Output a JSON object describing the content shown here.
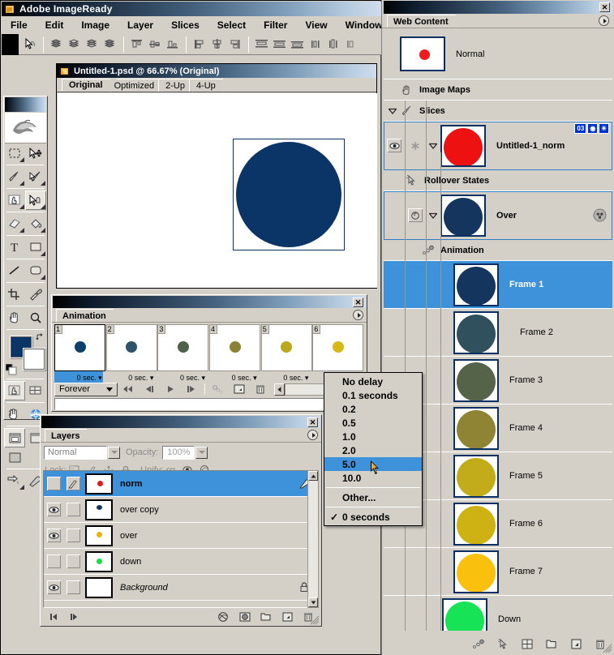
{
  "app": {
    "title": "Adobe ImageReady",
    "icon": "imageready-logo-icon",
    "menus": [
      "File",
      "Edit",
      "Image",
      "Layer",
      "Slices",
      "Select",
      "Filter",
      "View",
      "Window"
    ]
  },
  "document": {
    "title": "Untitled-1.psd @ 66.67% (Original)",
    "tabs": [
      "Original",
      "Optimized",
      "2-Up",
      "4-Up"
    ],
    "active_tab": "Original",
    "canvas_shape_color": "#0a3566"
  },
  "colors": {
    "foreground": "#0a3566",
    "background": "#ffffff",
    "selection_blue": "#3d92d9",
    "panel_gray": "#d4d0c8",
    "slice_badge_blue": "#0033cc"
  },
  "toolbox": {
    "tools": [
      "rectangular-marquee-icon",
      "move-icon",
      "slice-icon",
      "slice-select-icon",
      "image-map-tool-icon",
      "image-map-select-icon",
      "eraser-icon",
      "paint-bucket-icon",
      "type-icon",
      "rectangle-shape-icon",
      "line-icon",
      "rounded-rectangle-icon",
      "crop-icon",
      "eyedropper-icon",
      "hand-icon",
      "zoom-icon"
    ],
    "selected_tool": "image-map-select-icon",
    "swatch_swap": "swap-colors-icon",
    "swatch_default": "default-colors-icon",
    "mode_toggles": [
      "toggle-image-map-visibility-icon",
      "toggle-slices-visibility-icon"
    ],
    "preview_toggles": [
      "preview-document-icon",
      "preview-in-browser-icon"
    ],
    "screen_modes": [
      "standard-screen-mode-icon",
      "full-screen-menubar-icon",
      "full-screen-icon"
    ],
    "jump_to": [
      "jump-to-photoshop-icon",
      "edit-in-imageready-icon"
    ]
  },
  "options_bar": {
    "cursor_tool": "image-map-select-icon",
    "groups": [
      [
        "bring-to-front-icon",
        "bring-forward-icon",
        "send-backward-icon",
        "send-to-back-icon"
      ],
      [
        "align-left-icon",
        "align-horizontal-center-icon",
        "align-right-icon",
        "align-top-icon",
        "align-vertical-center-icon",
        "align-bottom-icon"
      ],
      [
        "distribute-top-icon",
        "distribute-vertical-center-icon",
        "distribute-bottom-icon",
        "distribute-left-icon",
        "distribute-horizontal-center-icon",
        "distribute-right-icon"
      ]
    ]
  },
  "animation_panel": {
    "title": "Animation",
    "close_label": "✕",
    "menu_icon": "panel-menu-icon",
    "loop_option": "Forever",
    "frames": [
      {
        "number": "1",
        "delay": "0 sec.",
        "color": "#0f3f6b",
        "selected": true
      },
      {
        "number": "2",
        "delay": "0 sec.",
        "color": "#2b5468",
        "selected": false
      },
      {
        "number": "3",
        "delay": "0 sec.",
        "color": "#4d6247",
        "selected": false
      },
      {
        "number": "4",
        "delay": "0 sec.",
        "color": "#8b8333",
        "selected": false
      },
      {
        "number": "5",
        "delay": "0 sec.",
        "color": "#bba91c",
        "selected": false
      },
      {
        "number": "6",
        "delay": "0 sec.",
        "color": "#d6b81a",
        "selected": false
      }
    ],
    "controls": [
      "select-first-frame-icon",
      "select-previous-frame-icon",
      "play-animation-icon",
      "select-next-frame-icon",
      "tween-icon",
      "duplicate-frame-icon",
      "delete-frame-icon"
    ]
  },
  "delay_menu": {
    "items": [
      {
        "label": "No delay",
        "highlighted": false,
        "checked": false
      },
      {
        "label": "0.1 seconds",
        "highlighted": false,
        "checked": false
      },
      {
        "label": "0.2",
        "highlighted": false,
        "checked": false
      },
      {
        "label": "0.5",
        "highlighted": false,
        "checked": false
      },
      {
        "label": "1.0",
        "highlighted": false,
        "checked": false
      },
      {
        "label": "2.0",
        "highlighted": false,
        "checked": false
      },
      {
        "label": "5.0",
        "highlighted": true,
        "checked": false
      },
      {
        "label": "10.0",
        "highlighted": false,
        "checked": false
      }
    ],
    "other_label": "Other...",
    "current_label": "0 seconds",
    "check_glyph": "✓"
  },
  "layers_panel": {
    "title": "Layers",
    "close_label": "✕",
    "blend_mode": "Normal",
    "opacity_label": "Opacity:",
    "opacity_value": "100%",
    "lock_label": "Lock:",
    "lock_icons": [
      "lock-transparency-icon",
      "lock-image-icon",
      "lock-position-icon",
      "lock-all-icon"
    ],
    "unify_label": "Unify:",
    "unify_icons": [
      "unify-layer-position-icon",
      "unify-layer-visibility-icon",
      "unify-layer-style-icon"
    ],
    "layers": [
      {
        "name": "norm",
        "visible": false,
        "selected": true,
        "dot_color": "#e01b1b",
        "italic": false,
        "has_mask_brush": true,
        "locked": false
      },
      {
        "name": "over copy",
        "visible": true,
        "selected": false,
        "dot_color": "#14365e",
        "italic": false,
        "has_mask_brush": false,
        "locked": false
      },
      {
        "name": "over",
        "visible": true,
        "selected": false,
        "dot_color": "#e8b40a",
        "italic": false,
        "has_mask_brush": false,
        "locked": false
      },
      {
        "name": "down",
        "visible": false,
        "selected": false,
        "dot_color": "#19e03f",
        "italic": false,
        "has_mask_brush": false,
        "locked": false
      },
      {
        "name": "Background",
        "visible": true,
        "selected": false,
        "dot_color": "",
        "italic": true,
        "has_mask_brush": false,
        "locked": true
      }
    ],
    "bottom_icons": [
      "layer-style-icon",
      "layer-mask-icon",
      "new-group-icon",
      "new-layer-icon",
      "delete-layer-icon"
    ]
  },
  "web_content_panel": {
    "title": "Web Content",
    "close_label": "✕",
    "menu_icon": "panel-menu-icon",
    "normal_state": {
      "label": "Normal",
      "dot_color": "#ee1c1c"
    },
    "sections": [
      {
        "label": "Image Maps",
        "icon": "image-map-icon",
        "expanded": false
      },
      {
        "label": "Slices",
        "icon": "slice-knife-icon",
        "expanded": true
      }
    ],
    "slice": {
      "name": "Untitled-1_norm",
      "color": "#ee1111",
      "badges": [
        "03",
        "rollover-badge-icon",
        "animation-badge-icon"
      ],
      "visible": true,
      "selected": true
    },
    "rollover_states_label": "Rollover States",
    "rollover_state": {
      "label": "Over",
      "color": "#14365e",
      "right_icon": "rollover-options-icon"
    },
    "animation_label": "Animation",
    "animation_frames": [
      {
        "label": "Frame 1",
        "color": "#14365e",
        "selected": true
      },
      {
        "label": "Frame 2",
        "color": "#30505e",
        "selected": false
      },
      {
        "label": "Frame 3",
        "color": "#556349",
        "selected": false
      },
      {
        "label": "Frame 4",
        "color": "#8e8434",
        "selected": false
      },
      {
        "label": "Frame 5",
        "color": "#c2ac19",
        "selected": false
      },
      {
        "label": "Frame 6",
        "color": "#ceb113",
        "selected": false
      },
      {
        "label": "Frame 7",
        "color": "#f9c10d",
        "selected": false
      },
      {
        "label": "Down",
        "color": "#16e356",
        "selected": false
      }
    ],
    "bottom_icons": [
      "create-rollover-state-icon",
      "create-image-map-icon",
      "slice-divide-icon",
      "new-group-icon",
      "new-slice-icon",
      "delete-icon"
    ]
  }
}
